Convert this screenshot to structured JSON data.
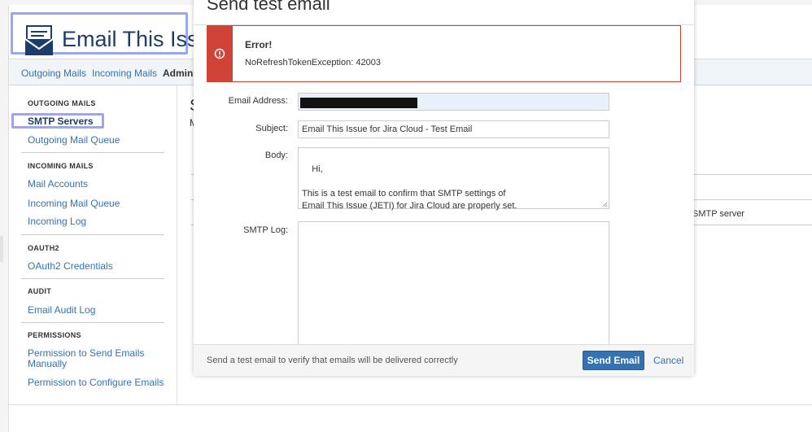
{
  "app": {
    "title": "Email This Issue"
  },
  "nav": {
    "items": [
      {
        "label": "Outgoing Mails"
      },
      {
        "label": "Incoming Mails"
      },
      {
        "label": "Adminis"
      }
    ]
  },
  "sidebar": {
    "sections": [
      {
        "heading": "OUTGOING MAILS",
        "items": [
          "SMTP Servers",
          "Outgoing Mail Queue"
        ]
      },
      {
        "heading": "INCOMING MAILS",
        "items": [
          "Mail Accounts",
          "Incoming Mail Queue",
          "Incoming Log"
        ]
      },
      {
        "heading": "OAUTH2",
        "items": [
          "OAuth2 Credentials"
        ]
      },
      {
        "heading": "AUDIT",
        "items": [
          "Email Audit Log"
        ]
      },
      {
        "heading": "PERMISSIONS",
        "items": [
          "Permission to Send Emails Manually",
          "Permission to Configure Emails"
        ]
      }
    ]
  },
  "main": {
    "heading_fragment": "S",
    "sub_fragment": "M",
    "row_fragment": "SMTP server"
  },
  "modal": {
    "title": "Send test email",
    "error": {
      "title": "Error!",
      "message": "NoRefreshTokenException: 42003"
    },
    "labels": {
      "email": "Email Address:",
      "subject": "Subject:",
      "body": "Body:",
      "log": "SMTP Log:"
    },
    "values": {
      "subject": "Email This Issue for Jira Cloud - Test Email",
      "body": "Hi,\n\nThis is a test email to confirm that SMTP settings of\nEmail This Issue (JETI) for Jira Cloud are properly set."
    },
    "footer_hint": "Send a test email to verify that emails will be delivered correctly",
    "send_label": "Send Email",
    "cancel_label": "Cancel"
  },
  "colors": {
    "accent": "#3572b0",
    "error": "#d04437",
    "highlight": "#9aa6f2"
  }
}
